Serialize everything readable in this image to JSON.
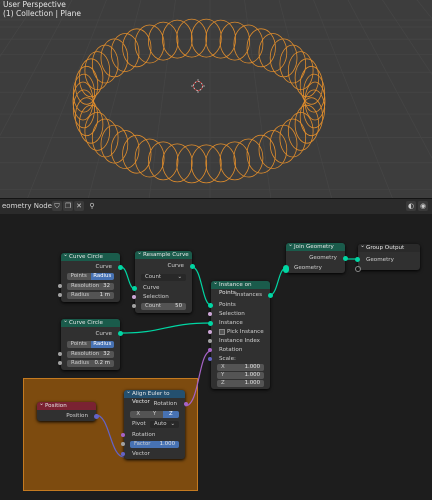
{
  "viewport": {
    "line1": "User Perspective",
    "line2": "(1) Collection | Plane"
  },
  "editor_header": {
    "title": "eometry Nodes",
    "icons": [
      "shield-icon",
      "duplicate-icon",
      "delete-icon",
      "pin-icon"
    ]
  },
  "colors": {
    "geometry_socket": "#00d6a3",
    "ring_orange": "#e08d2c",
    "frame": "#7d4b0f",
    "selected_field": "#4772b3"
  },
  "nodes": {
    "curve_circle_1": {
      "title": "Curve Circle",
      "out": "Curve",
      "mode": [
        "Points",
        "Radius"
      ],
      "resolution_label": "Resolution",
      "resolution": "32",
      "radius_label": "Radius",
      "radius": "1 m"
    },
    "resample": {
      "title": "Resample Curve",
      "out": "Curve",
      "mode": "Count",
      "in_curve": "Curve",
      "in_selection": "Selection",
      "count_label": "Count",
      "count": "50"
    },
    "curve_circle_2": {
      "title": "Curve Circle",
      "out": "Curve",
      "mode": [
        "Points",
        "Radius"
      ],
      "resolution_label": "Resolution",
      "resolution": "32",
      "radius_label": "Radius",
      "radius": "0.2 m"
    },
    "instance_on_points": {
      "title": "Instance on Points",
      "out": "Instances",
      "inputs": [
        "Points",
        "Selection",
        "Instance",
        "Pick Instance",
        "Instance Index",
        "Rotation",
        "Scale:"
      ],
      "scale": [
        {
          "axis": "X",
          "value": "1.000"
        },
        {
          "axis": "Y",
          "value": "1.000"
        },
        {
          "axis": "Z",
          "value": "1.000"
        }
      ]
    },
    "join_geometry": {
      "title": "Join Geometry",
      "out": "Geometry",
      "in": "Geometry"
    },
    "group_output": {
      "title": "Group Output",
      "in": "Geometry"
    },
    "position": {
      "title": "Position",
      "out": "Position"
    },
    "align_euler": {
      "title": "Align Euler to Vector",
      "out": "Rotation",
      "axes": [
        "X",
        "Y",
        "Z"
      ],
      "pivot_label": "Pivot",
      "pivot": "Auto",
      "in_rotation": "Rotation",
      "factor_label": "Factor",
      "factor": "1.000",
      "in_vector": "Vector"
    }
  }
}
